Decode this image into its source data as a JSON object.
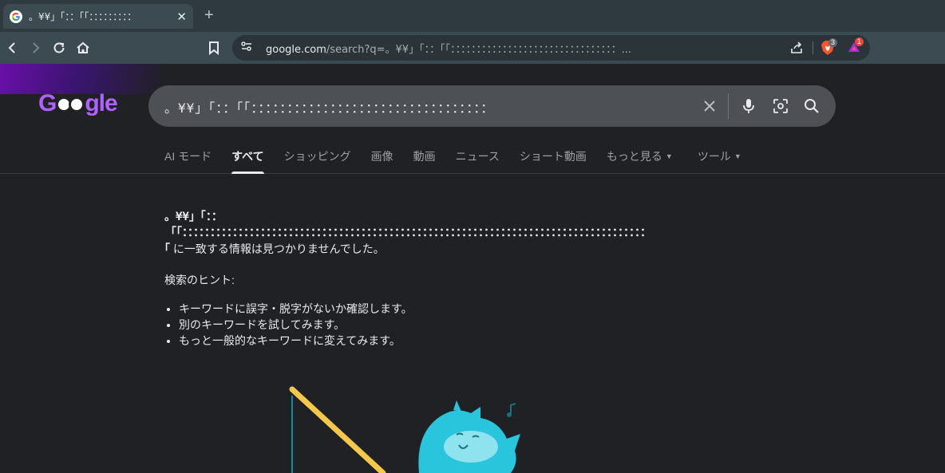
{
  "browser": {
    "tab_title": "。¥¥」｢：：｢｢：：：：：：：：：",
    "new_tab": "+",
    "omnibox_domain": "google.com",
    "omnibox_path": "/search?q=。¥¥」｢：：｢｢：：：：：：：：：：：：：：：：：：：：：：：：：：：：：：：：...",
    "brave_badge": "3",
    "rewards_badge": "1"
  },
  "google": {
    "logo": "Google",
    "search_query": "。¥¥」｢：：｢｢：：：：：：：：：：：：：：：：：：：：：：：：：：：：：：：：：",
    "tabs": [
      {
        "label": "AI モード"
      },
      {
        "label": "すべて"
      },
      {
        "label": "ショッピング"
      },
      {
        "label": "画像"
      },
      {
        "label": "動画"
      },
      {
        "label": "ニュース"
      },
      {
        "label": "ショート動画"
      },
      {
        "label": "もっと見る"
      },
      {
        "label": "ツール"
      }
    ]
  },
  "results": {
    "query_line1": "。¥¥」｢：：",
    "query_line2": "｢｢：：：：：：：：：：：：：：：：：：：：：：：：：：：：：：：：：：：：：：：：：：：：：：：：：：：：：：：：：：：：：：：：：：：：：：：：：：：：：：：：：：：",
    "query_tail_bracket": "｢",
    "no_match": " に一致する情報は見つかりませんでした。",
    "hint_title": "検索のヒント:",
    "hints": [
      "キーワードに誤字・脱字がないか確認します。",
      "別のキーワードを試してみます。",
      "もっと一般的なキーワードに変えてみます。"
    ]
  },
  "colors": {
    "background": "#202124",
    "chrome_tabstrip": "#2f3a40",
    "chrome_toolbar": "#3c4a51",
    "logo": "#b061ff",
    "searchbox": "#4d5156"
  }
}
